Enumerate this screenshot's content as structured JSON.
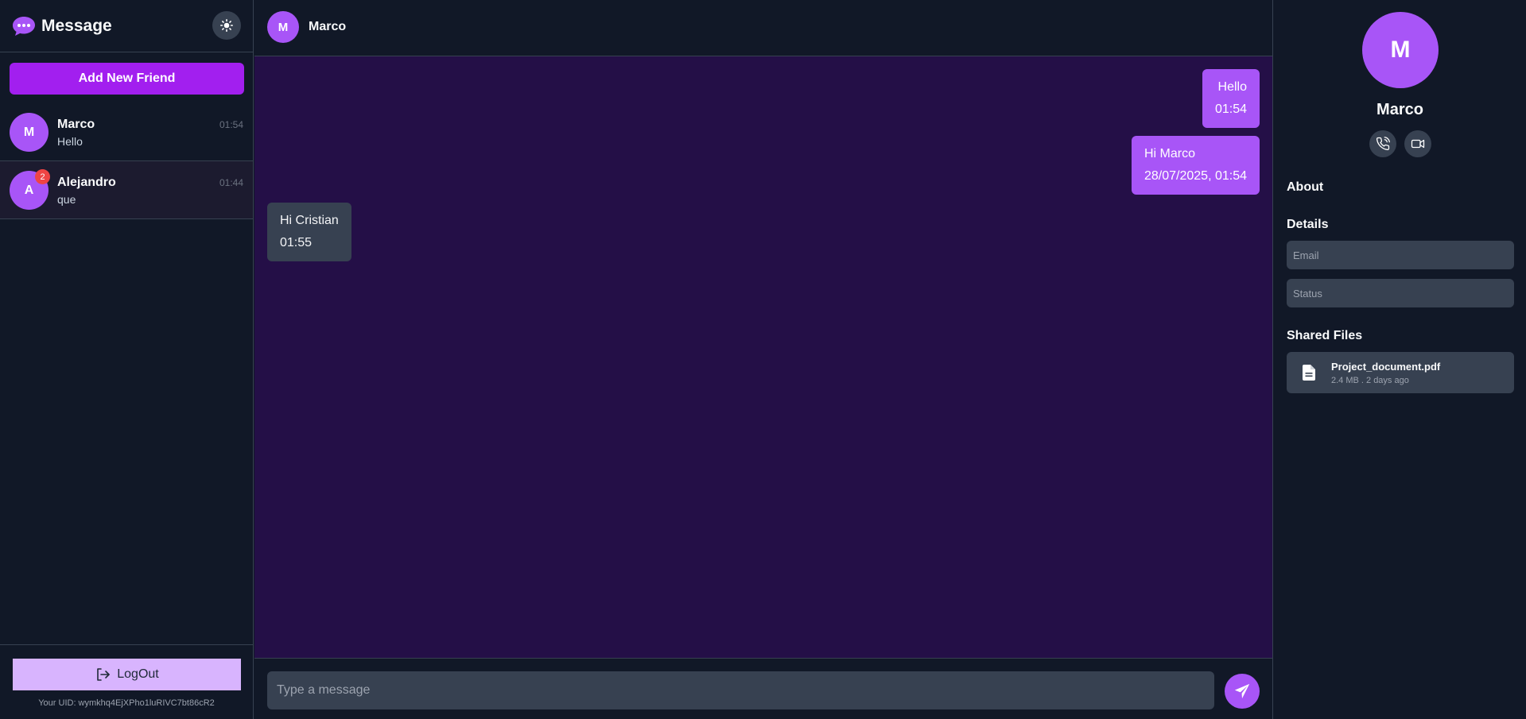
{
  "app": {
    "title": "Message"
  },
  "colors": {
    "accent": "#a855f7",
    "accent_strong": "#a21fef",
    "chat_bg": "#240f47",
    "panel_bg": "#111827",
    "badge": "#ef4444",
    "logout_bg": "#d8b4fe"
  },
  "sidebar": {
    "add_friend_label": "Add New Friend",
    "contacts": [
      {
        "initial": "M",
        "name": "Marco",
        "last_message": "Hello",
        "time": "01:54",
        "unread": null
      },
      {
        "initial": "A",
        "name": "Alejandro",
        "last_message": "que",
        "time": "01:44",
        "unread": "2"
      }
    ],
    "logout_label": "LogOut",
    "uid_text": "Your UID: wymkhq4EjXPho1luRIVC7bt86cR2"
  },
  "chat": {
    "contact_initial": "M",
    "contact_name": "Marco",
    "messages": [
      {
        "direction": "sent",
        "text": "Hello",
        "time": "01:54"
      },
      {
        "direction": "sent",
        "text": "Hi Marco",
        "time": "28/07/2025, 01:54"
      },
      {
        "direction": "received",
        "text": "Hi Cristian",
        "time": "01:55"
      }
    ],
    "input_placeholder": "Type a message",
    "input_value": ""
  },
  "profile": {
    "initial": "M",
    "name": "Marco",
    "about_heading": "About",
    "details_heading": "Details",
    "email_placeholder": "Email",
    "status_placeholder": "Status",
    "shared_files_heading": "Shared Files",
    "files": [
      {
        "name": "Project_document.pdf",
        "meta": "2.4 MB . 2 days ago"
      }
    ]
  }
}
